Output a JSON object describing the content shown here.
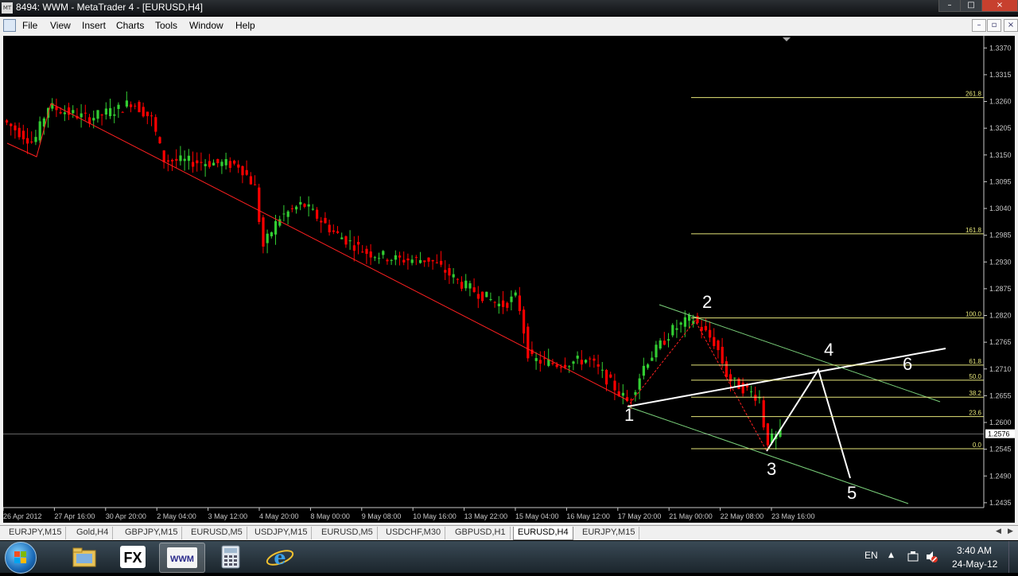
{
  "window": {
    "title": "8494: WWM - MetaTrader 4 - [EURUSD,H4]",
    "app_icon": "mt4-app-icon",
    "controls": [
      "minimize-icon",
      "maximize-icon",
      "close-icon"
    ]
  },
  "menu": {
    "items": [
      "File",
      "View",
      "Insert",
      "Charts",
      "Tools",
      "Window",
      "Help"
    ],
    "mdi_controls": [
      "–",
      "▫",
      "×"
    ]
  },
  "chart": {
    "symbol": "EURUSD",
    "timeframe": "H4",
    "background": "#000000",
    "bull_color": "#32cd32",
    "bear_color": "#ff0000",
    "price_axis": [
      "1.3370",
      "1.3315",
      "1.3260",
      "1.3205",
      "1.3150",
      "1.3095",
      "1.3040",
      "1.2985",
      "1.2930",
      "1.2875",
      "1.2820",
      "1.2765",
      "1.2710",
      "1.2655",
      "1.2600",
      "1.2545",
      "1.2490",
      "1.2435"
    ],
    "price_range": [
      1.2425,
      1.3395
    ],
    "current_price": "1.2576",
    "time_axis": [
      "26 Apr 2012",
      "27 Apr 16:00",
      "30 Apr 20:00",
      "2 May 04:00",
      "3 May 12:00",
      "4 May 20:00",
      "8 May 00:00",
      "9 May 08:00",
      "10 May 16:00",
      "13 May 22:00",
      "15 May 04:00",
      "16 May 12:00",
      "17 May 20:00",
      "21 May 00:00",
      "22 May 08:00",
      "23 May 16:00"
    ],
    "fibonacci": {
      "color": "#e6e67a",
      "levels": [
        {
          "label": "261.8",
          "price": 1.3268
        },
        {
          "label": "161.8",
          "price": 1.2988
        },
        {
          "label": "100.0",
          "price": 1.2815
        },
        {
          "label": "61.8",
          "price": 1.2718
        },
        {
          "label": "50.0",
          "price": 1.2687
        },
        {
          "label": "38.2",
          "price": 1.2652
        },
        {
          "label": "23.6",
          "price": 1.2612
        },
        {
          "label": "0.0",
          "price": 1.2546
        }
      ]
    },
    "wave_labels": [
      "1",
      "2",
      "3",
      "4",
      "5",
      "6"
    ]
  },
  "tabs": {
    "items": [
      "EURJPY,M15",
      "Gold,H4",
      "GBPJPY,M15",
      "EURUSD,M5",
      "USDJPY,M15",
      "EURUSD,M5",
      "USDCHF,M30",
      "GBPUSD,H1",
      "EURUSD,H4",
      "EURJPY,M15"
    ],
    "active_index": 8
  },
  "taskbar": {
    "apps": [
      "folder-icon",
      "fx-icon",
      "wwm-icon",
      "calculator-icon",
      "internet-explorer-icon"
    ],
    "active_app": 2,
    "fx_label": "FX",
    "wwm_label": "WWM",
    "language": "EN",
    "time": "3:40 AM",
    "date": "24-May-12"
  }
}
